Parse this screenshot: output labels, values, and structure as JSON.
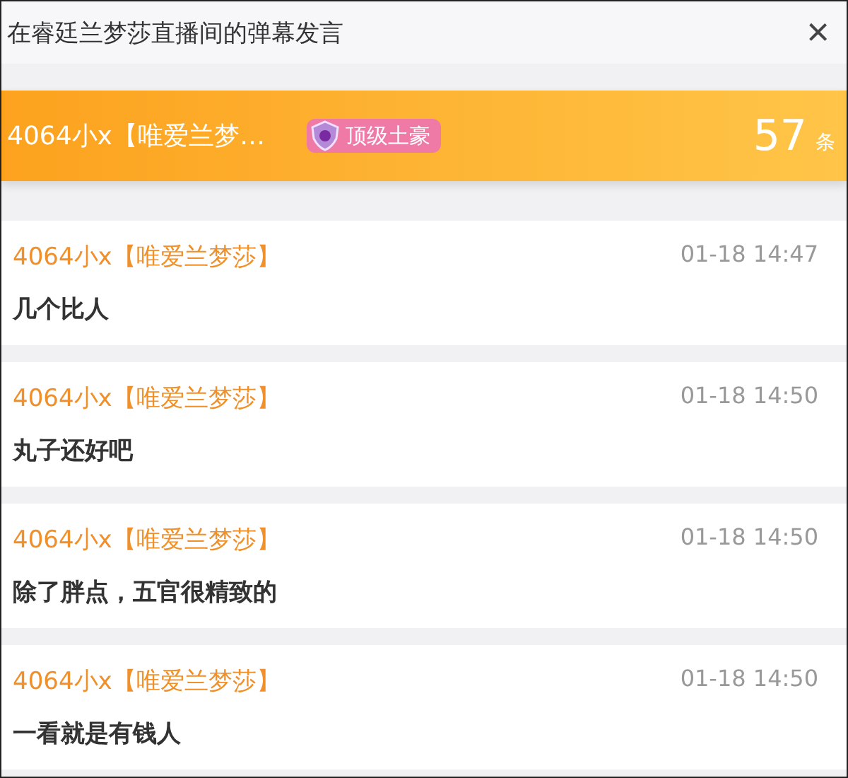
{
  "window": {
    "title": "在睿廷兰梦莎直播间的弹幕发言",
    "close": "×"
  },
  "summary": {
    "user": "4064小x【唯爱兰梦…",
    "badge": "顶级土豪",
    "count": "57",
    "unit": "条"
  },
  "messages": [
    {
      "user": "4064小x【唯爱兰梦莎】",
      "time": "01-18 14:47",
      "text": "几个比人"
    },
    {
      "user": "4064小x【唯爱兰梦莎】",
      "time": "01-18 14:50",
      "text": "丸子还好吧"
    },
    {
      "user": "4064小x【唯爱兰梦莎】",
      "time": "01-18 14:50",
      "text": "除了胖点，五官很精致的"
    },
    {
      "user": "4064小x【唯爱兰梦莎】",
      "time": "01-18 14:50",
      "text": "一看就是有钱人"
    }
  ]
}
